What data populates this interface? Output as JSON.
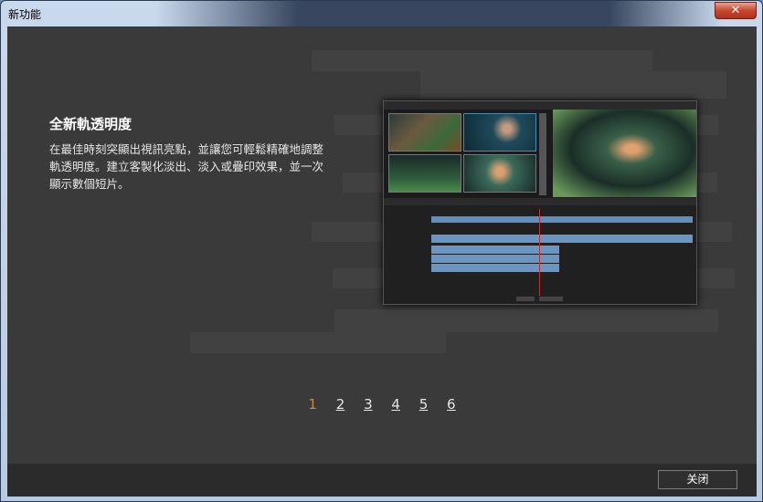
{
  "window": {
    "title": "新功能",
    "close_glyph": "✕"
  },
  "feature": {
    "heading": "全新軌透明度",
    "description": "在最佳時刻突顯出視訊亮點，並讓您可輕鬆精確地調整軌透明度。建立客製化淡出、淡入或疊印效果，並一次顯示數個短片。"
  },
  "pager": {
    "pages": [
      "1",
      "2",
      "3",
      "4",
      "5",
      "6"
    ],
    "active": "1"
  },
  "footer": {
    "close_label": "关闭"
  },
  "colors": {
    "accent": "#d08a3c",
    "content_bg": "#3a3a3a",
    "footer_bg": "#2b2b2b"
  }
}
